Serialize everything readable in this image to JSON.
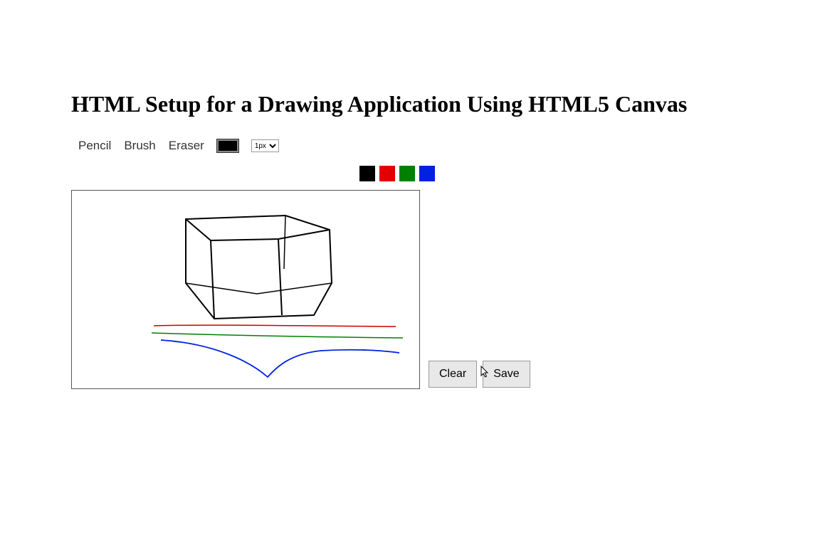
{
  "title": "HTML Setup for a Drawing Application Using HTML5 Canvas",
  "tools": {
    "pencil": "Pencil",
    "brush": "Brush",
    "eraser": "Eraser"
  },
  "size_selected": "1px",
  "palette": {
    "black": "#000000",
    "red": "#e20000",
    "green": "#008000",
    "blue": "#0020e2"
  },
  "buttons": {
    "clear": "Clear",
    "save": "Save"
  }
}
